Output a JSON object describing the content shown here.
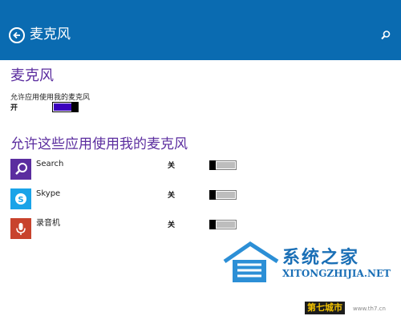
{
  "header": {
    "title": "麦克风",
    "back_icon": "back-arrow-icon",
    "search_icon": "search-icon"
  },
  "microphone": {
    "section_title": "麦克风",
    "setting_label": "允许应用使用我的麦克风",
    "state_label": "开",
    "enabled": true
  },
  "apps": {
    "section_title": "允许这些应用使用我的麦克风",
    "items": [
      {
        "name": "Search",
        "state_label": "关",
        "enabled": false,
        "icon": "search-icon",
        "icon_color": "#5b2d9f"
      },
      {
        "name": "Skype",
        "state_label": "关",
        "enabled": false,
        "icon": "skype-icon",
        "icon_color": "#1aa3e8"
      },
      {
        "name": "录音机",
        "state_label": "关",
        "enabled": false,
        "icon": "microphone-icon",
        "icon_color": "#c8432d"
      }
    ]
  },
  "colors": {
    "header_bg": "#0a6bb1",
    "accent_purple": "#5b2d9f",
    "toggle_on": "#3b00bd"
  },
  "watermark": {
    "text": "系统之家",
    "url": "XITONGZHIJIA.NET"
  },
  "badge": {
    "text": "第七城市",
    "url": "www.th7.cn"
  }
}
